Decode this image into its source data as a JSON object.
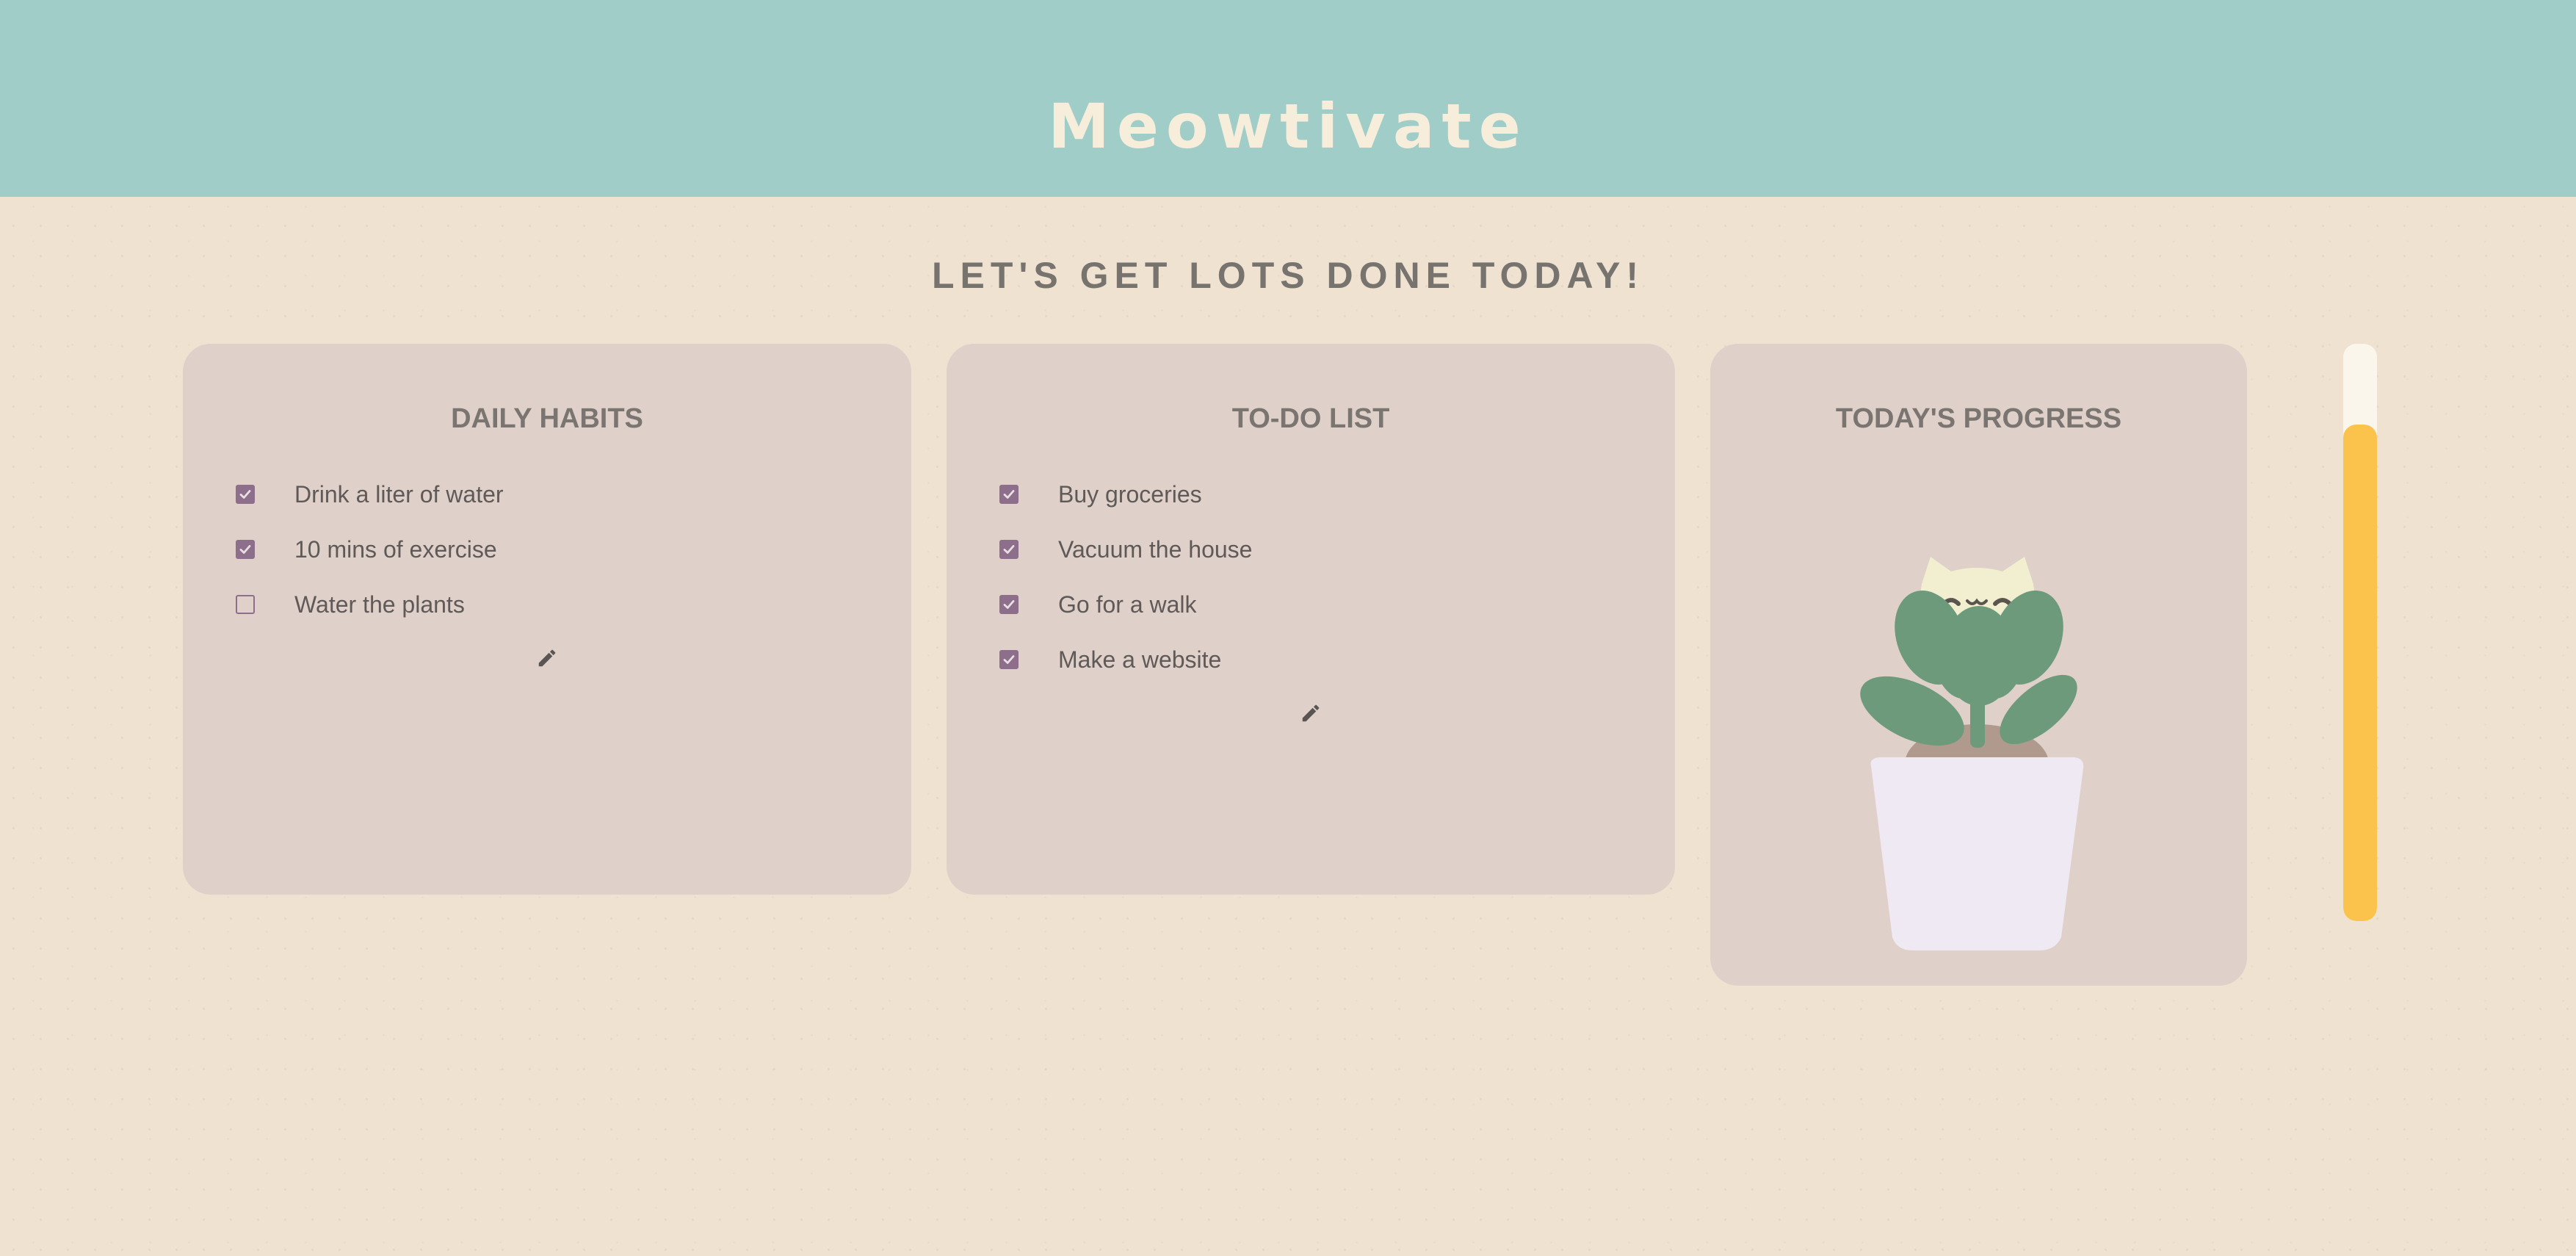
{
  "app": {
    "title": "Meowtivate",
    "tagline": "LET'S GET LOTS DONE TODAY!"
  },
  "habits": {
    "title": "DAILY HABITS",
    "items": [
      {
        "label": "Drink a liter of water",
        "checked": true
      },
      {
        "label": "10 mins of exercise",
        "checked": true
      },
      {
        "label": "Water the plants",
        "checked": false
      }
    ],
    "edit_icon": "pencil-icon"
  },
  "todo": {
    "title": "TO-DO LIST",
    "items": [
      {
        "label": "Buy groceries",
        "checked": true
      },
      {
        "label": "Vacuum the house",
        "checked": true
      },
      {
        "label": "Go for a walk",
        "checked": true
      },
      {
        "label": "Make a website",
        "checked": true
      }
    ],
    "edit_icon": "pencil-icon"
  },
  "progress": {
    "title": "TODAY'S PROGRESS",
    "illustration": "cat-plant-illustration",
    "level": 0.86
  },
  "colors": {
    "header": "#a1cdc9",
    "background": "#efe2d0",
    "card": "#dfd0c9",
    "checkbox": "#8e6f8b",
    "progress_fill": "#fbc34b",
    "progress_track": "#fbf6ec"
  }
}
